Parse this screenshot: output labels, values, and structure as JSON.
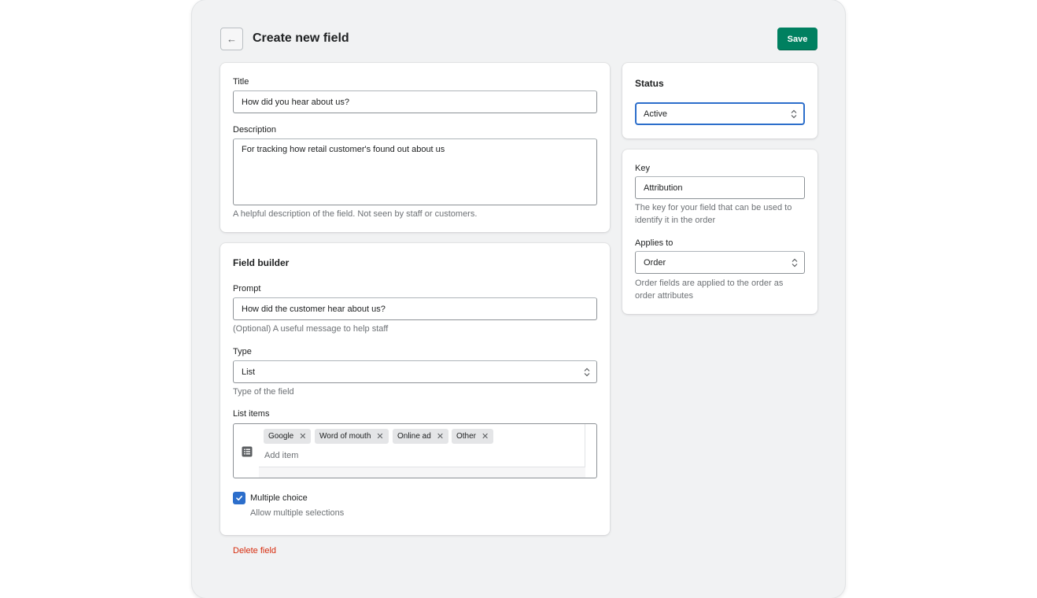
{
  "header": {
    "back_icon": "←",
    "title": "Create new field",
    "save_label": "Save"
  },
  "details": {
    "title_label": "Title",
    "title_value": "How did you hear about us?",
    "description_label": "Description",
    "description_value": "For tracking how retail customer's found out about us",
    "description_help": "A helpful description of the field. Not seen by staff or customers."
  },
  "builder": {
    "heading": "Field builder",
    "prompt_label": "Prompt",
    "prompt_value": "How did the customer hear about us?",
    "prompt_help": "(Optional) A useful message to help staff",
    "type_label": "Type",
    "type_value": "List",
    "type_help": "Type of the field",
    "list_label": "List items",
    "list_items": [
      "Google",
      "Word of mouth",
      "Online ad",
      "Other"
    ],
    "remove_icon": "✕",
    "add_item_placeholder": "Add item",
    "multiple_label": "Multiple choice",
    "multiple_help": "Allow multiple selections",
    "multiple_checked": true
  },
  "status": {
    "heading": "Status",
    "value": "Active"
  },
  "key_card": {
    "key_label": "Key",
    "key_value": "Attribution",
    "key_help_line1": "The key for your field that can be used to",
    "key_help_line2": "identify it in the order",
    "applies_label": "Applies to",
    "applies_value": "Order",
    "applies_help_line1": "Order fields are applied to the order as",
    "applies_help_line2": "order attributes"
  },
  "footer": {
    "delete_label": "Delete field"
  },
  "colors": {
    "primary": "#008060",
    "focus": "#2c6ecb",
    "critical": "#d72c0d"
  }
}
